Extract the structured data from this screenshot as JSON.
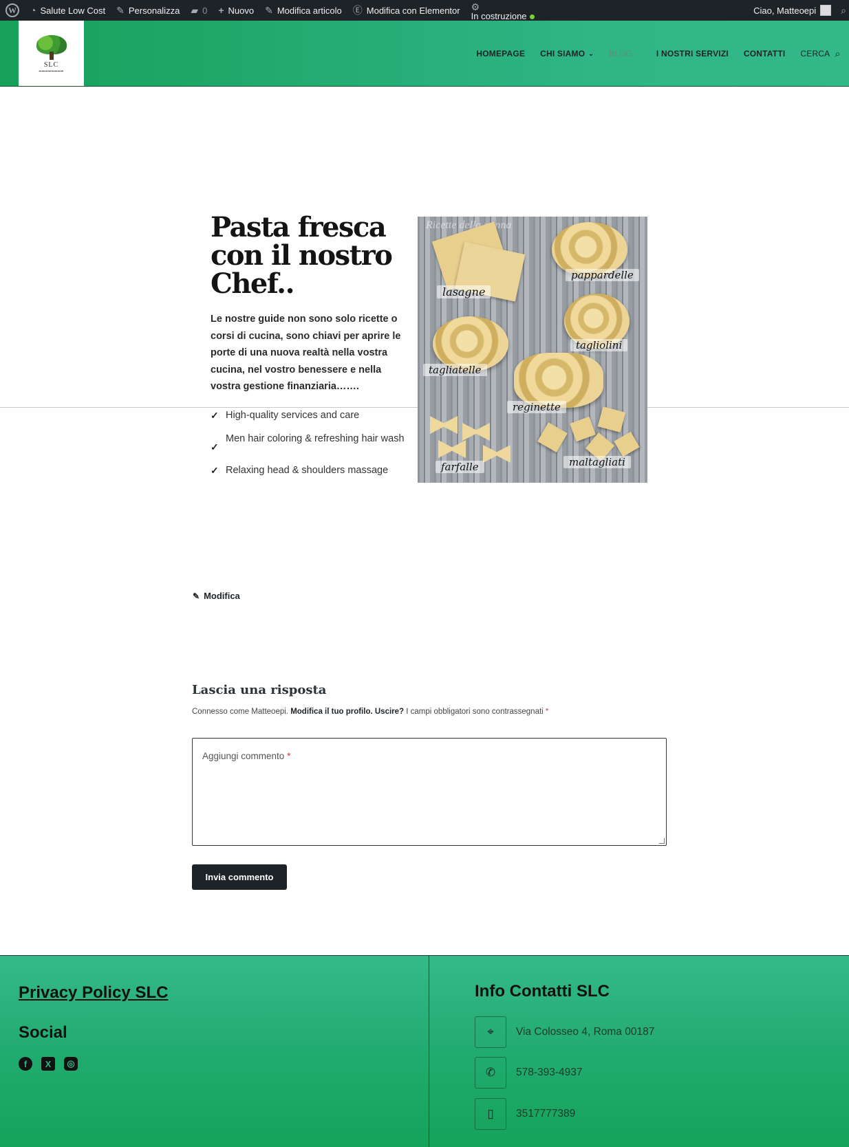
{
  "adminbar": {
    "items": [
      {
        "icon": "dashboard-icon",
        "label": "Salute Low Cost"
      },
      {
        "icon": "brush-icon",
        "label": "Personalizza"
      },
      {
        "icon": "comment-icon",
        "label": "0"
      },
      {
        "icon": "plus-icon",
        "label": "Nuovo"
      },
      {
        "icon": "pencil-icon",
        "label": "Modifica articolo"
      },
      {
        "icon": "elementor-icon",
        "label": "Modifica con Elementor"
      }
    ],
    "status_label": "In costruzione",
    "status_color": "#7ad03a",
    "greeting": "Ciao, Matteoepi"
  },
  "header": {
    "logo_text": "SLC",
    "nav": [
      {
        "label": "HOMEPAGE"
      },
      {
        "label": "CHI SIAMO"
      },
      {
        "label": "BLOG"
      },
      {
        "label": "I NOSTRI SERVIZI"
      },
      {
        "label": "CONTATTI"
      }
    ],
    "search_label": "CERCA",
    "colors": {
      "primary": "#17a05a",
      "secondary": "#33b889"
    }
  },
  "hero": {
    "title": "Pasta fresca con il nostro Chef..",
    "description": "Le nostre guide non sono solo ricette o corsi di cucina, sono chiavi per aprire le porte di una nuova realtà nella vostra cucina, nel vostro benessere e nella vostra gestione finanziaria…….",
    "features": [
      "High-quality services and care",
      "Men hair coloring & refreshing hair wash",
      "Relaxing head & shoulders massage"
    ],
    "image_labels": {
      "watermark": "Ricette della nonna",
      "lasagne": "lasagne",
      "pappardelle": "pappardelle",
      "tagliolini": "tagliolini",
      "tagliatelle": "tagliatelle",
      "reginette": "reginette",
      "farfalle": "farfalle",
      "maltagliati": "maltagliati"
    }
  },
  "edit_link": "Modifica",
  "comments": {
    "title": "Lascia una risposta",
    "logged_in_prefix": "Connesso come Matteoepi.",
    "edit_profile": "Modifica il tuo profilo.",
    "logout": "Uscire?",
    "required_note": "I campi obbligatori sono contrassegnati",
    "required_mark": "*",
    "placeholder": "Aggiungi commento",
    "submit_label": "Invia commento"
  },
  "footer": {
    "privacy_link": "Privacy Policy SLC",
    "social_title": "Social",
    "social_icons": [
      "facebook-icon",
      "x-twitter-icon",
      "instagram-icon"
    ],
    "contacts_title": "Info Contatti SLC",
    "contacts": [
      {
        "icon": "location-pin-icon",
        "text": "Via Colosseo 4, Roma 00187"
      },
      {
        "icon": "phone-icon",
        "text": "578-393-4937"
      },
      {
        "icon": "mobile-icon",
        "text": "3517777389"
      }
    ]
  }
}
